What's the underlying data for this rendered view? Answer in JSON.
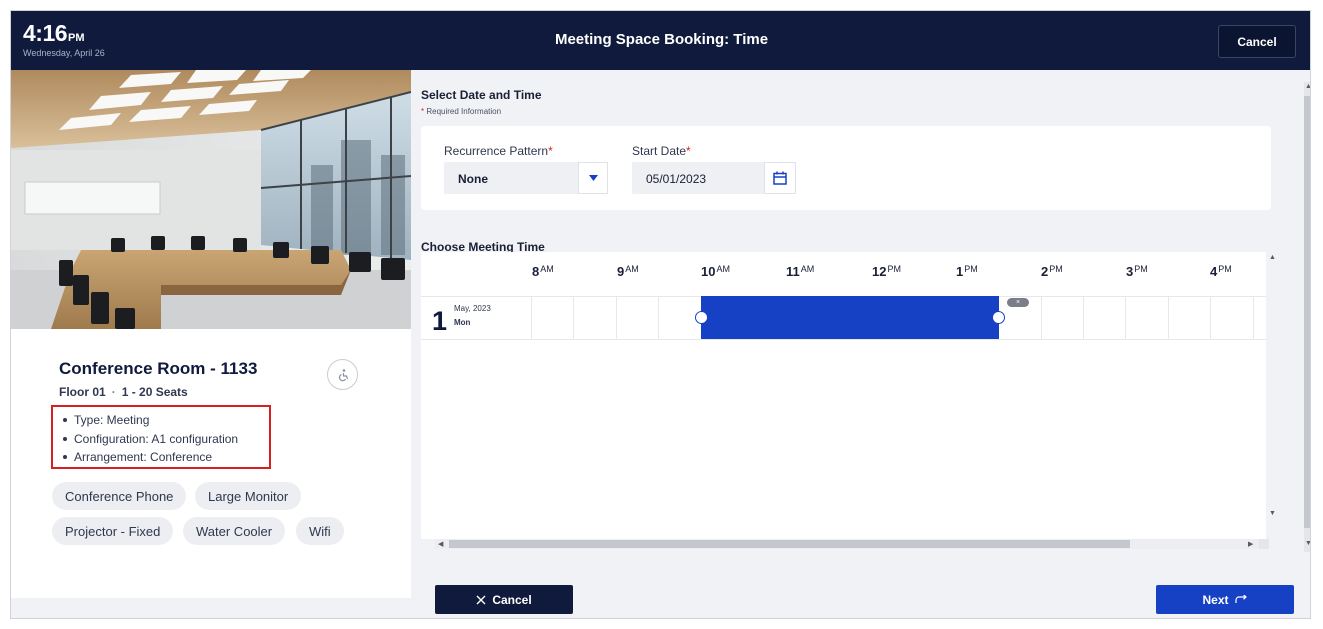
{
  "header": {
    "time": "4:16",
    "ampm": "PM",
    "date": "Wednesday, April 26",
    "title": "Meeting Space Booking: Time",
    "cancel_label": "Cancel"
  },
  "room": {
    "name": "Conference Room - 1133",
    "floor": "Floor 01",
    "seats": "1 - 20 Seats",
    "details": [
      "Type: Meeting",
      "Configuration: A1 configuration",
      "Arrangement: Conference"
    ],
    "amenities": [
      "Conference Phone",
      "Large Monitor",
      "Projector - Fixed",
      "Water Cooler",
      "Wifi"
    ]
  },
  "form": {
    "section_title": "Select Date and Time",
    "required_note": "Required Information",
    "recurrence_label": "Recurrence Pattern",
    "recurrence_value": "None",
    "start_date_label": "Start Date",
    "start_date_value": "05/01/2023"
  },
  "schedule": {
    "section_title": "Choose Meeting Time",
    "hours": [
      {
        "num": "8",
        "ampm": "AM"
      },
      {
        "num": "9",
        "ampm": "AM"
      },
      {
        "num": "10",
        "ampm": "AM"
      },
      {
        "num": "11",
        "ampm": "AM"
      },
      {
        "num": "12",
        "ampm": "PM"
      },
      {
        "num": "1",
        "ampm": "PM"
      },
      {
        "num": "2",
        "ampm": "PM"
      },
      {
        "num": "3",
        "ampm": "PM"
      },
      {
        "num": "4",
        "ampm": "PM"
      }
    ],
    "day": {
      "num": "1",
      "month_year": "May, 2023",
      "weekday": "Mon"
    },
    "booking_remove_glyph": "×"
  },
  "footer": {
    "cancel_label": "Cancel",
    "next_label": "Next"
  },
  "colors": {
    "header_bg": "#0f1a3c",
    "accent_blue": "#1741c5",
    "highlight_red": "#d61f1f"
  }
}
